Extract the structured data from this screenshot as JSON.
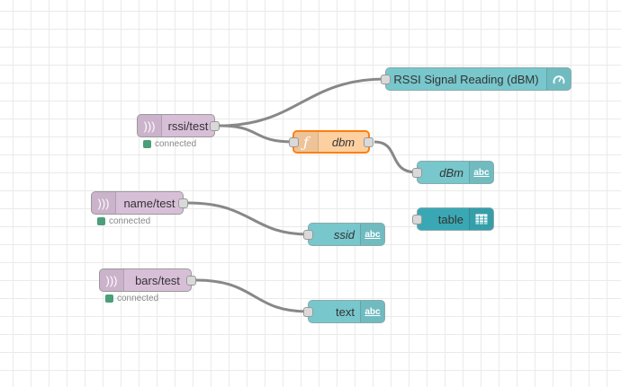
{
  "nodes": {
    "rssi_in": {
      "label": "rssi/test",
      "status": "connected",
      "icon": "mqtt-wave-icon"
    },
    "name_in": {
      "label": "name/test",
      "status": "connected",
      "icon": "mqtt-wave-icon"
    },
    "bars_in": {
      "label": "bars/test",
      "status": "connected",
      "icon": "mqtt-wave-icon"
    },
    "gauge": {
      "label": "RSSI Signal Reading (dBM)",
      "icon": "gauge-icon"
    },
    "func": {
      "label": "dbm",
      "icon": "function-icon",
      "glyph": "ƒ"
    },
    "dbm_text": {
      "label": "dBm",
      "icon": "text-icon",
      "glyph": "abc"
    },
    "ssid_text": {
      "label": "ssid",
      "icon": "text-icon",
      "glyph": "abc"
    },
    "table": {
      "label": "table",
      "icon": "table-icon"
    },
    "text": {
      "label": "text",
      "icon": "text-icon",
      "glyph": "abc"
    }
  },
  "colors": {
    "mqtt": "#d8bfd8",
    "dashboard": "#78c7cc",
    "table": "#3aa8b4",
    "function": "#fdd0a2",
    "status_ok": "#4a9e7a"
  }
}
